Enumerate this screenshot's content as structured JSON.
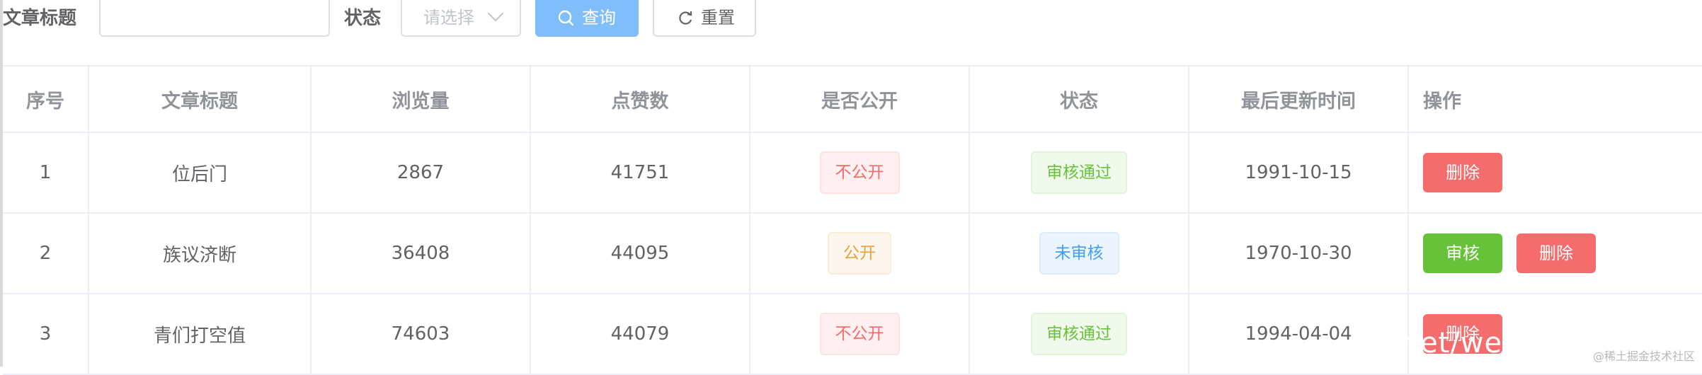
{
  "search": {
    "title_label": "文章标题",
    "title_value": "",
    "status_label": "状态",
    "status_placeholder": "请选择",
    "search_button": "查询",
    "reset_button": "重置"
  },
  "table": {
    "headers": [
      "序号",
      "文章标题",
      "浏览量",
      "点赞数",
      "是否公开",
      "状态",
      "最后更新时间",
      "操作"
    ],
    "rows": [
      {
        "index": "1",
        "title": "位后门",
        "views": "2867",
        "likes": "41751",
        "public": "不公开",
        "status": "审核通过",
        "updated": "1991-10-15",
        "actions": [
          "删除"
        ]
      },
      {
        "index": "2",
        "title": "族议济断",
        "views": "36408",
        "likes": "44095",
        "public": "公开",
        "status": "未审核",
        "updated": "1970-10-30",
        "actions": [
          "审核",
          "删除"
        ]
      },
      {
        "index": "3",
        "title": "青们打空值",
        "views": "74603",
        "likes": "44079",
        "public": "不公开",
        "status": "审核通过",
        "updated": "1994-04-04",
        "actions": [
          "删除"
        ]
      }
    ]
  },
  "overlay": {
    "url_fragment": ".net/we",
    "watermark": "@稀土掘金技术社区"
  },
  "colors": {
    "primary": "#409eff",
    "danger": "#f56c6c",
    "success": "#67c23a",
    "warning": "#e6a23c"
  },
  "icons": {
    "search": "search-icon",
    "reset": "refresh-icon",
    "select": "chevron-down-icon"
  }
}
